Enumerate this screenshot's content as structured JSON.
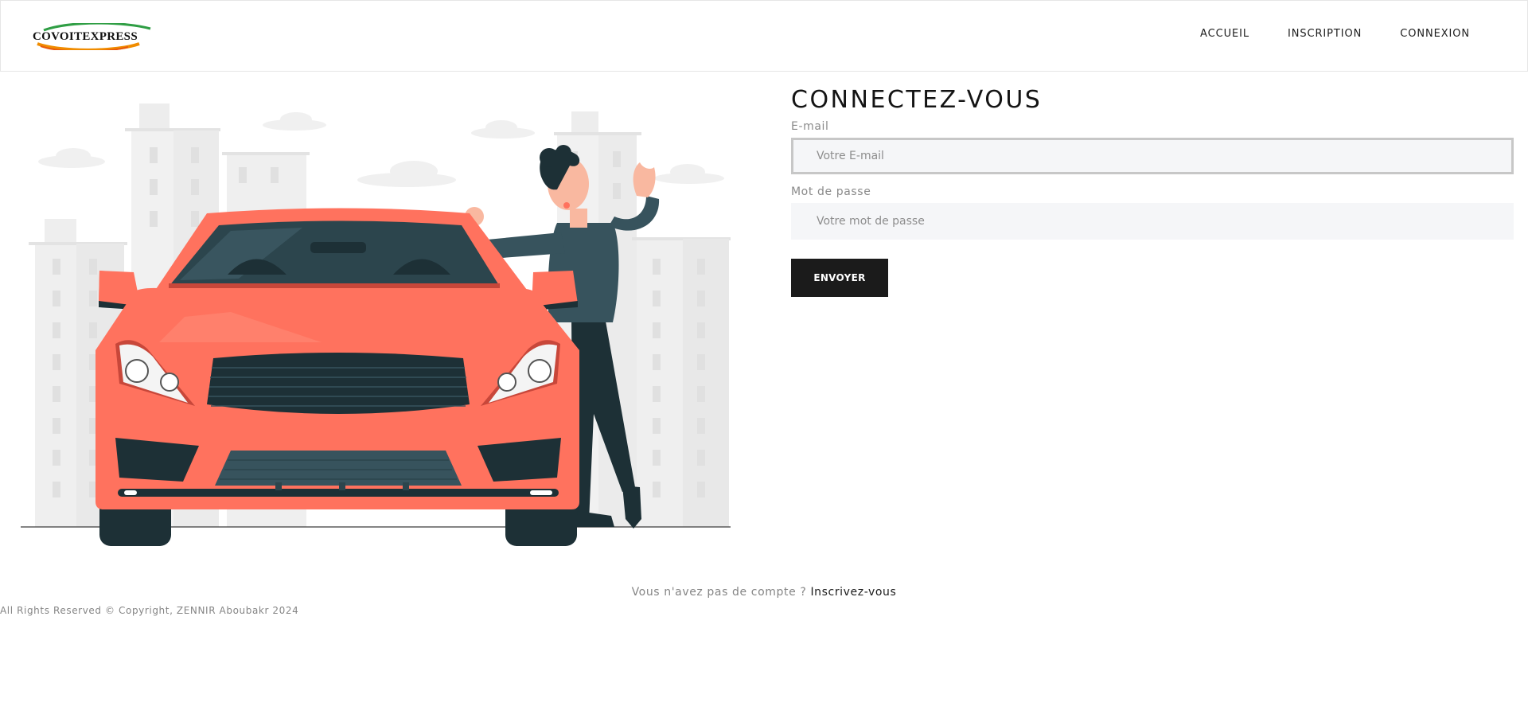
{
  "header": {
    "logo_text": "COVOITEXPRESS",
    "nav": [
      {
        "label": "ACCUEIL"
      },
      {
        "label": "INSCRIPTION"
      },
      {
        "label": "CONNEXION"
      }
    ]
  },
  "login": {
    "title": "CONNECTEZ-VOUS",
    "email_label": "E-mail",
    "email_placeholder": "Votre E-mail",
    "email_value": "",
    "password_label": "Mot de passe",
    "password_placeholder": "Votre mot de passe",
    "password_value": "",
    "submit_label": "ENVOYER"
  },
  "signup": {
    "prompt": "Vous n'avez pas de compte ?",
    "link": "Inscrivez-vous"
  },
  "footer": {
    "copyright": "All Rights Reserved © Copyright, ZENNIR Aboubakr 2024"
  },
  "colors": {
    "car": "#ff725e",
    "car_dark": "#e3503f",
    "dark_teal": "#1d3036",
    "sweater": "#37535d",
    "button": "#1b1b1b",
    "input_bg": "#f5f6f8"
  },
  "icons": {
    "logo": "covoitexpress-logo"
  }
}
